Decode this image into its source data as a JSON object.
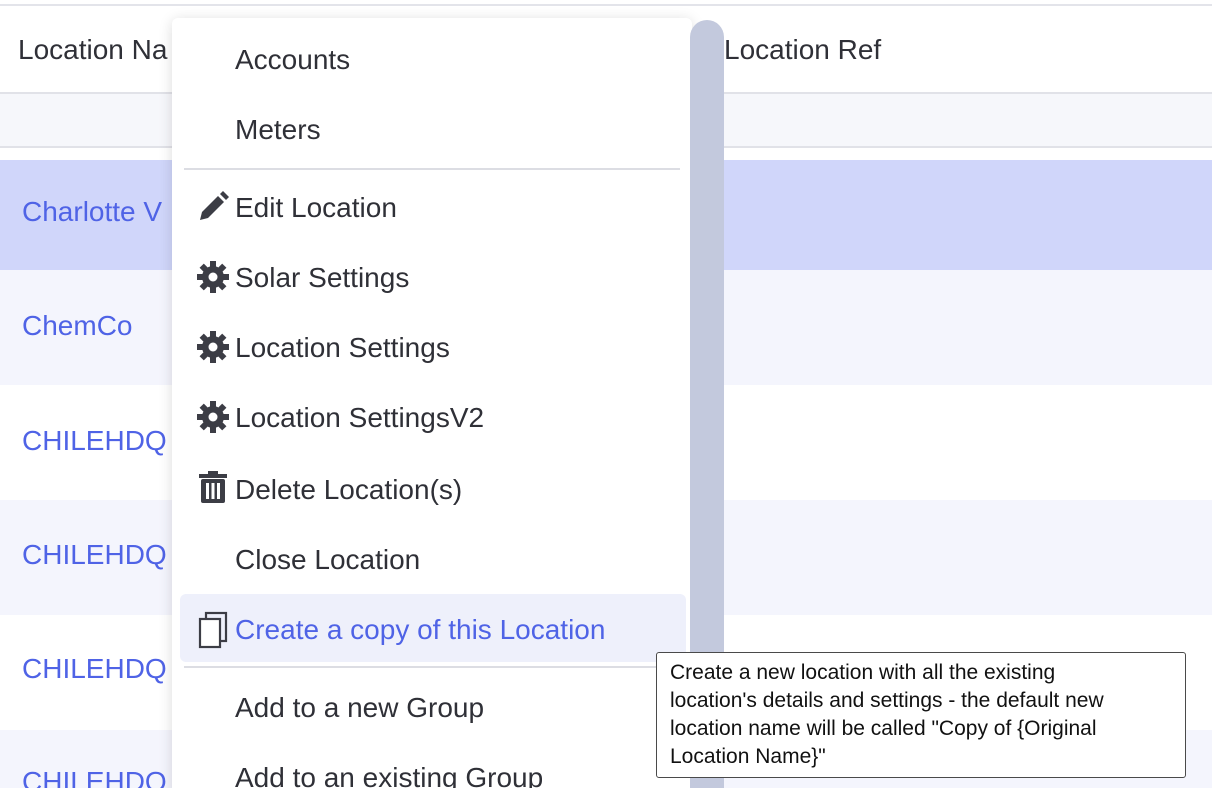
{
  "table": {
    "columns": [
      "Location Na",
      "Location Ref"
    ],
    "rows": [
      {
        "name": "Charlotte V",
        "selected": true
      },
      {
        "name": "ChemCo"
      },
      {
        "name": "CHILEHDQ"
      },
      {
        "name": "CHILEHDQ"
      },
      {
        "name": "CHILEHDQ"
      },
      {
        "name": "CHILEHDQ"
      }
    ],
    "colors": {
      "selected_row": "#d0d6fa",
      "striped_row": "#f4f5fd",
      "link": "#4f63e6"
    }
  },
  "menu": {
    "items": [
      {
        "label": "Accounts",
        "icon": null
      },
      {
        "label": "Meters",
        "icon": null
      },
      {
        "label": "Edit Location",
        "icon": "pencil-icon"
      },
      {
        "label": "Solar Settings",
        "icon": "gear-icon"
      },
      {
        "label": "Location Settings",
        "icon": "gear-icon"
      },
      {
        "label": "Location SettingsV2",
        "icon": "gear-icon"
      },
      {
        "label": "Delete Location(s)",
        "icon": "trash-icon"
      },
      {
        "label": "Close Location",
        "icon": null
      },
      {
        "label": "Create a copy of this Location",
        "icon": "copy-icon",
        "highlighted": true
      },
      {
        "label": "Add to a new Group",
        "icon": null
      },
      {
        "label": "Add to an existing Group",
        "icon": null
      }
    ]
  },
  "tooltip": {
    "lines": [
      "Create a new location with all the existing",
      "location's details and settings - the default new",
      "location name will be called \"Copy of {Original",
      "Location Name}\""
    ]
  }
}
